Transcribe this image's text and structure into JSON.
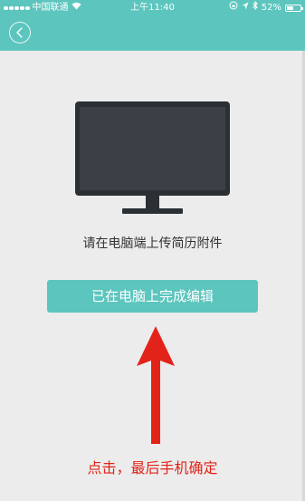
{
  "status_bar": {
    "carrier": "中国联通",
    "time": "上午11:40",
    "battery": "52%",
    "battery_level": 0.52,
    "icons": [
      "signal-dots-icon",
      "wifi-icon",
      "lock-rotation-icon",
      "location-icon",
      "bluetooth-icon",
      "battery-icon"
    ]
  },
  "nav": {
    "back_icon": "chevron-left-icon"
  },
  "main": {
    "illustration": "monitor-icon",
    "hint": "请在电脑端上传简历附件",
    "done_button_label": "已在电脑上完成编辑"
  },
  "annotation": {
    "arrow_icon": "red-up-arrow-icon",
    "text": "点击，最后手机确定"
  },
  "colors": {
    "accent": "#5cc5be",
    "background": "#ececec",
    "annotation": "#e2231a",
    "monitor_screen": "#3b4046",
    "monitor_frame": "#2b3035"
  }
}
